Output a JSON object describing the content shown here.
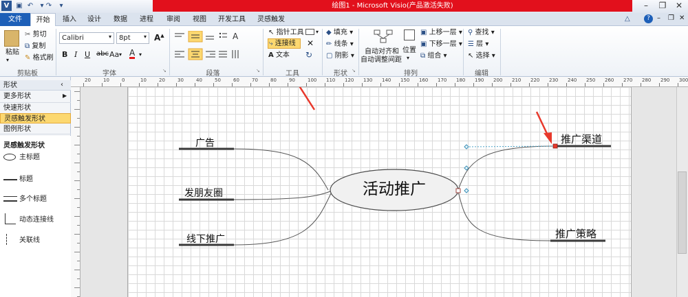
{
  "window": {
    "title": "绘图1 - Microsoft Visio(产品激活失败)"
  },
  "ribbon_tabs": [
    "文件",
    "开始",
    "插入",
    "设计",
    "数据",
    "进程",
    "审阅",
    "视图",
    "开发工具",
    "灵感触发"
  ],
  "clipboard": {
    "paste": "粘贴",
    "cut": "剪切",
    "copy": "复制",
    "format_painter": "格式刷",
    "group_label": "剪贴板"
  },
  "font": {
    "name": "Calibri",
    "size": "8pt",
    "group_label": "字体"
  },
  "paragraph": {
    "group_label": "段落"
  },
  "tools": {
    "pointer": "指针工具",
    "connector": "连接线",
    "text": "文本",
    "group_label": "工具"
  },
  "shape": {
    "fill": "填充",
    "line": "线条",
    "shadow": "阴影",
    "group_label": "形状"
  },
  "arrange": {
    "auto_align_1": "自动对齐和",
    "auto_align_2": "自动调整间距",
    "position": "位置",
    "bring_forward": "上移一层",
    "send_backward": "下移一层",
    "group": "组合",
    "group_label": "排列"
  },
  "editing": {
    "find": "查找",
    "layers": "层",
    "select": "选择",
    "group_label": "编辑"
  },
  "sidebar": {
    "header": "形状",
    "menu": [
      "更多形状",
      "快速形状",
      "灵感触发形状",
      "图例形状"
    ],
    "section_title": "灵感触发形状",
    "shapes": [
      "主标题",
      "标题",
      "多个标题",
      "动态连接线",
      "关联线"
    ]
  },
  "ruler": {
    "ticks": [
      "20",
      "10",
      "0",
      "10",
      "20",
      "30",
      "40",
      "50",
      "60",
      "70",
      "80",
      "90",
      "100",
      "110",
      "120",
      "130",
      "140",
      "150",
      "160",
      "170",
      "180",
      "190",
      "200",
      "210",
      "220",
      "230",
      "240",
      "250",
      "260",
      "270",
      "280",
      "290",
      "300"
    ]
  },
  "diagram": {
    "main_topic": "活动推广",
    "branches": [
      "广告",
      "发朋友圈",
      "线下推广",
      "推广渠道",
      "推广策略"
    ]
  },
  "colors": {
    "title_bar": "#e2101c",
    "file_tab": "#1d5fb8",
    "connector_highlight": "#fcd870",
    "annotation_arrow": "#e8382b"
  }
}
